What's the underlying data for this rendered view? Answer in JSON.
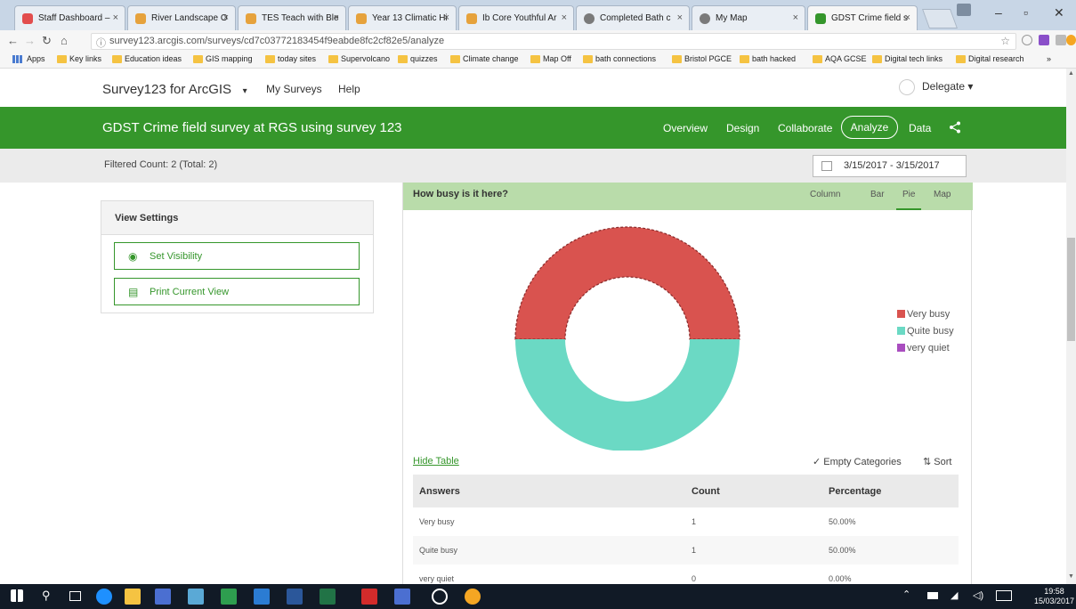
{
  "browser": {
    "tabs": [
      {
        "label": "Staff Dashboard –",
        "color": "#e24d4d"
      },
      {
        "label": "River Landscape O",
        "color": "#e6a23c"
      },
      {
        "label": "TES Teach with Ble",
        "color": "#e6a23c"
      },
      {
        "label": "Year 13 Climatic Hi",
        "color": "#e6a23c"
      },
      {
        "label": "Ib Core Youthful Ar",
        "color": "#e6a23c"
      },
      {
        "label": "Completed Bath c",
        "color": "#7a7a7a"
      },
      {
        "label": "My Map",
        "color": "#7a7a7a"
      },
      {
        "label": "GDST Crime field s",
        "color": "#35962b"
      }
    ],
    "url": "survey123.arcgis.com/surveys/cd7c03772183454f9eabde8fc2cf82e5/analyze",
    "bookmarks": [
      "Apps",
      "Key links",
      "Education ideas",
      "GIS mapping",
      "today sites",
      "Supervolcano",
      "quizzes",
      "Climate change",
      "Map Off",
      "bath connections",
      "Bristol PGCE",
      "bath hacked",
      "AQA GCSE",
      "Digital tech links",
      "Digital research"
    ],
    "more": "»"
  },
  "app": {
    "brand": "Survey123 for ArcGIS",
    "brand_caret": "▾",
    "my_surveys": "My Surveys",
    "help": "Help",
    "user": "Delegate ▾"
  },
  "survey": {
    "title": "GDST Crime field survey at RGS using survey 123",
    "nav": {
      "overview": "Overview",
      "design": "Design",
      "collaborate": "Collaborate",
      "analyze": "Analyze",
      "data": "Data"
    }
  },
  "filter": {
    "count": "Filtered Count: 2 (Total: 2)",
    "date_range": "3/15/2017 - 3/15/2017"
  },
  "view_settings": {
    "title": "View Settings",
    "set_visibility": "Set Visibility",
    "print_view": "Print Current View"
  },
  "question": {
    "title": "How busy is it here?",
    "chart_tabs": [
      "Column",
      "Bar",
      "Pie",
      "Map"
    ],
    "hide_table": "Hide Table",
    "empty_categories": "✓ Empty Categories",
    "sort": "⇅ Sort"
  },
  "chart_data": {
    "type": "pie",
    "title": "How busy is it here?",
    "categories": [
      "Very busy",
      "Quite busy",
      "very quiet"
    ],
    "values": [
      1,
      1,
      0
    ],
    "colors": [
      "#d9534f",
      "#6bd9c4",
      "#a94dbf"
    ],
    "legend": "right"
  },
  "table": {
    "headers": [
      "Answers",
      "Count",
      "Percentage"
    ],
    "rows": [
      [
        "Very busy",
        "1",
        "50.00%"
      ],
      [
        "Quite busy",
        "1",
        "50.00%"
      ],
      [
        "very quiet",
        "0",
        "0.00%"
      ]
    ]
  },
  "taskbar": {
    "time": "19:58",
    "date": "15/03/2017"
  }
}
